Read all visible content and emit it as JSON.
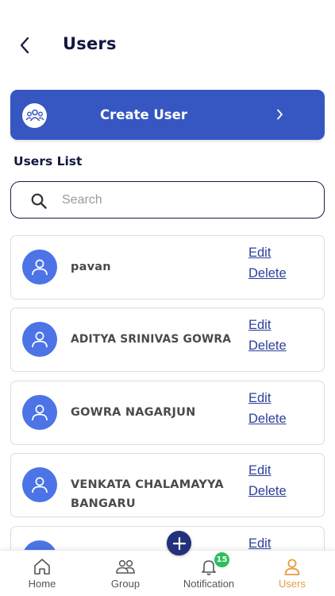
{
  "header": {
    "title": "Users"
  },
  "create_user": {
    "label": "Create User"
  },
  "users_list": {
    "title": "Users List"
  },
  "search": {
    "placeholder": "Search",
    "value": ""
  },
  "users": [
    {
      "name": "pavan",
      "edit": "Edit",
      "delete": "Delete"
    },
    {
      "name": "ADITYA SRINIVAS GOWRA",
      "edit": "Edit",
      "delete": "Delete"
    },
    {
      "name": "GOWRA NAGARJUN",
      "edit": "Edit",
      "delete": "Delete"
    },
    {
      "name": "VENKATA CHALAMAYYA BANGARU",
      "edit": "Edit",
      "delete": "Delete"
    },
    {
      "name": "",
      "edit": "Edit",
      "delete": ""
    }
  ],
  "bottom_nav": {
    "items": [
      {
        "label": "Home",
        "icon": "home-icon"
      },
      {
        "label": "Group",
        "icon": "group-icon"
      },
      {
        "label": "Notification",
        "icon": "bell-icon"
      },
      {
        "label": "Users",
        "icon": "user-icon"
      }
    ],
    "active": "Users",
    "notification_count": "15"
  },
  "colors": {
    "primary": "#3657c2",
    "avatar": "#4c74e6",
    "link": "#2d3f9a",
    "active_nav": "#e89b3c",
    "badge": "#2bbf5a",
    "fab": "#23307a"
  }
}
